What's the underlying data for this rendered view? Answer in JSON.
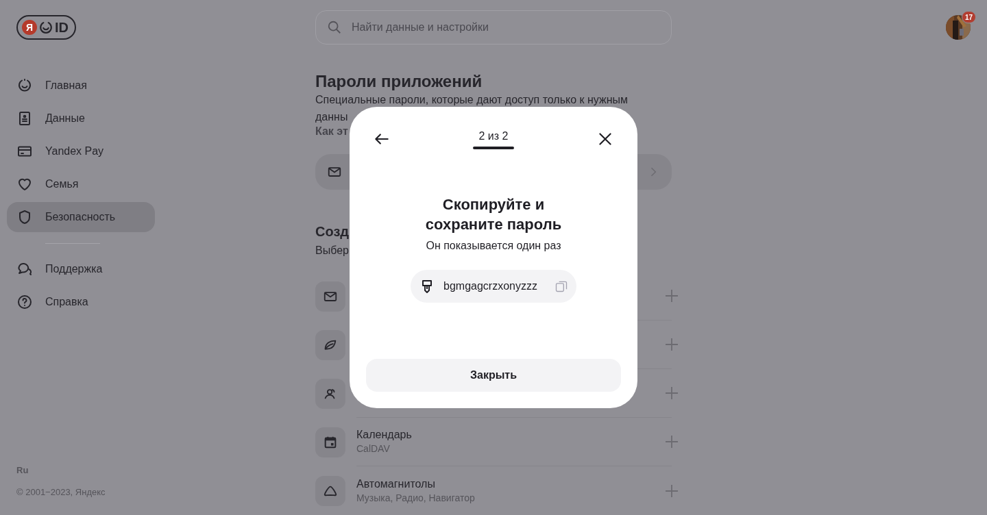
{
  "logo": {
    "mark": "Я",
    "text": "ID"
  },
  "search": {
    "placeholder": "Найти данные и настройки"
  },
  "avatar": {
    "badge": "17"
  },
  "sidebar": {
    "items": [
      {
        "label": "Главная",
        "selected": false
      },
      {
        "label": "Данные",
        "selected": false
      },
      {
        "label": "Yandex Pay",
        "selected": false
      },
      {
        "label": "Семья",
        "selected": false
      },
      {
        "label": "Безопасность",
        "selected": true
      }
    ],
    "secondary": [
      {
        "label": "Поддержка",
        "selected": false
      },
      {
        "label": "Справка",
        "selected": false
      }
    ],
    "language": "Ru",
    "copyright": "© 2001−2023, Яндекс"
  },
  "page": {
    "title": "Пароли приложений",
    "description": [
      "Специальные пароли, которые дают доступ только к нужным",
      "данны"
    ],
    "link": "Как эт",
    "section_title": "Созд",
    "section_subtitle": "Выбер",
    "rows": [
      {},
      {},
      {},
      {
        "title": "Календарь",
        "subtitle": "CalDAV"
      },
      {
        "title": "Автомагнитолы",
        "subtitle": "Музыка, Радио, Навигатор"
      }
    ]
  },
  "modal": {
    "step": "2 из 2",
    "title": "Скопируйте и сохраните пароль",
    "subtitle": "Он показывается один раз",
    "password": "bgmgagcrzxonyzzz",
    "button": "Закрыть"
  }
}
